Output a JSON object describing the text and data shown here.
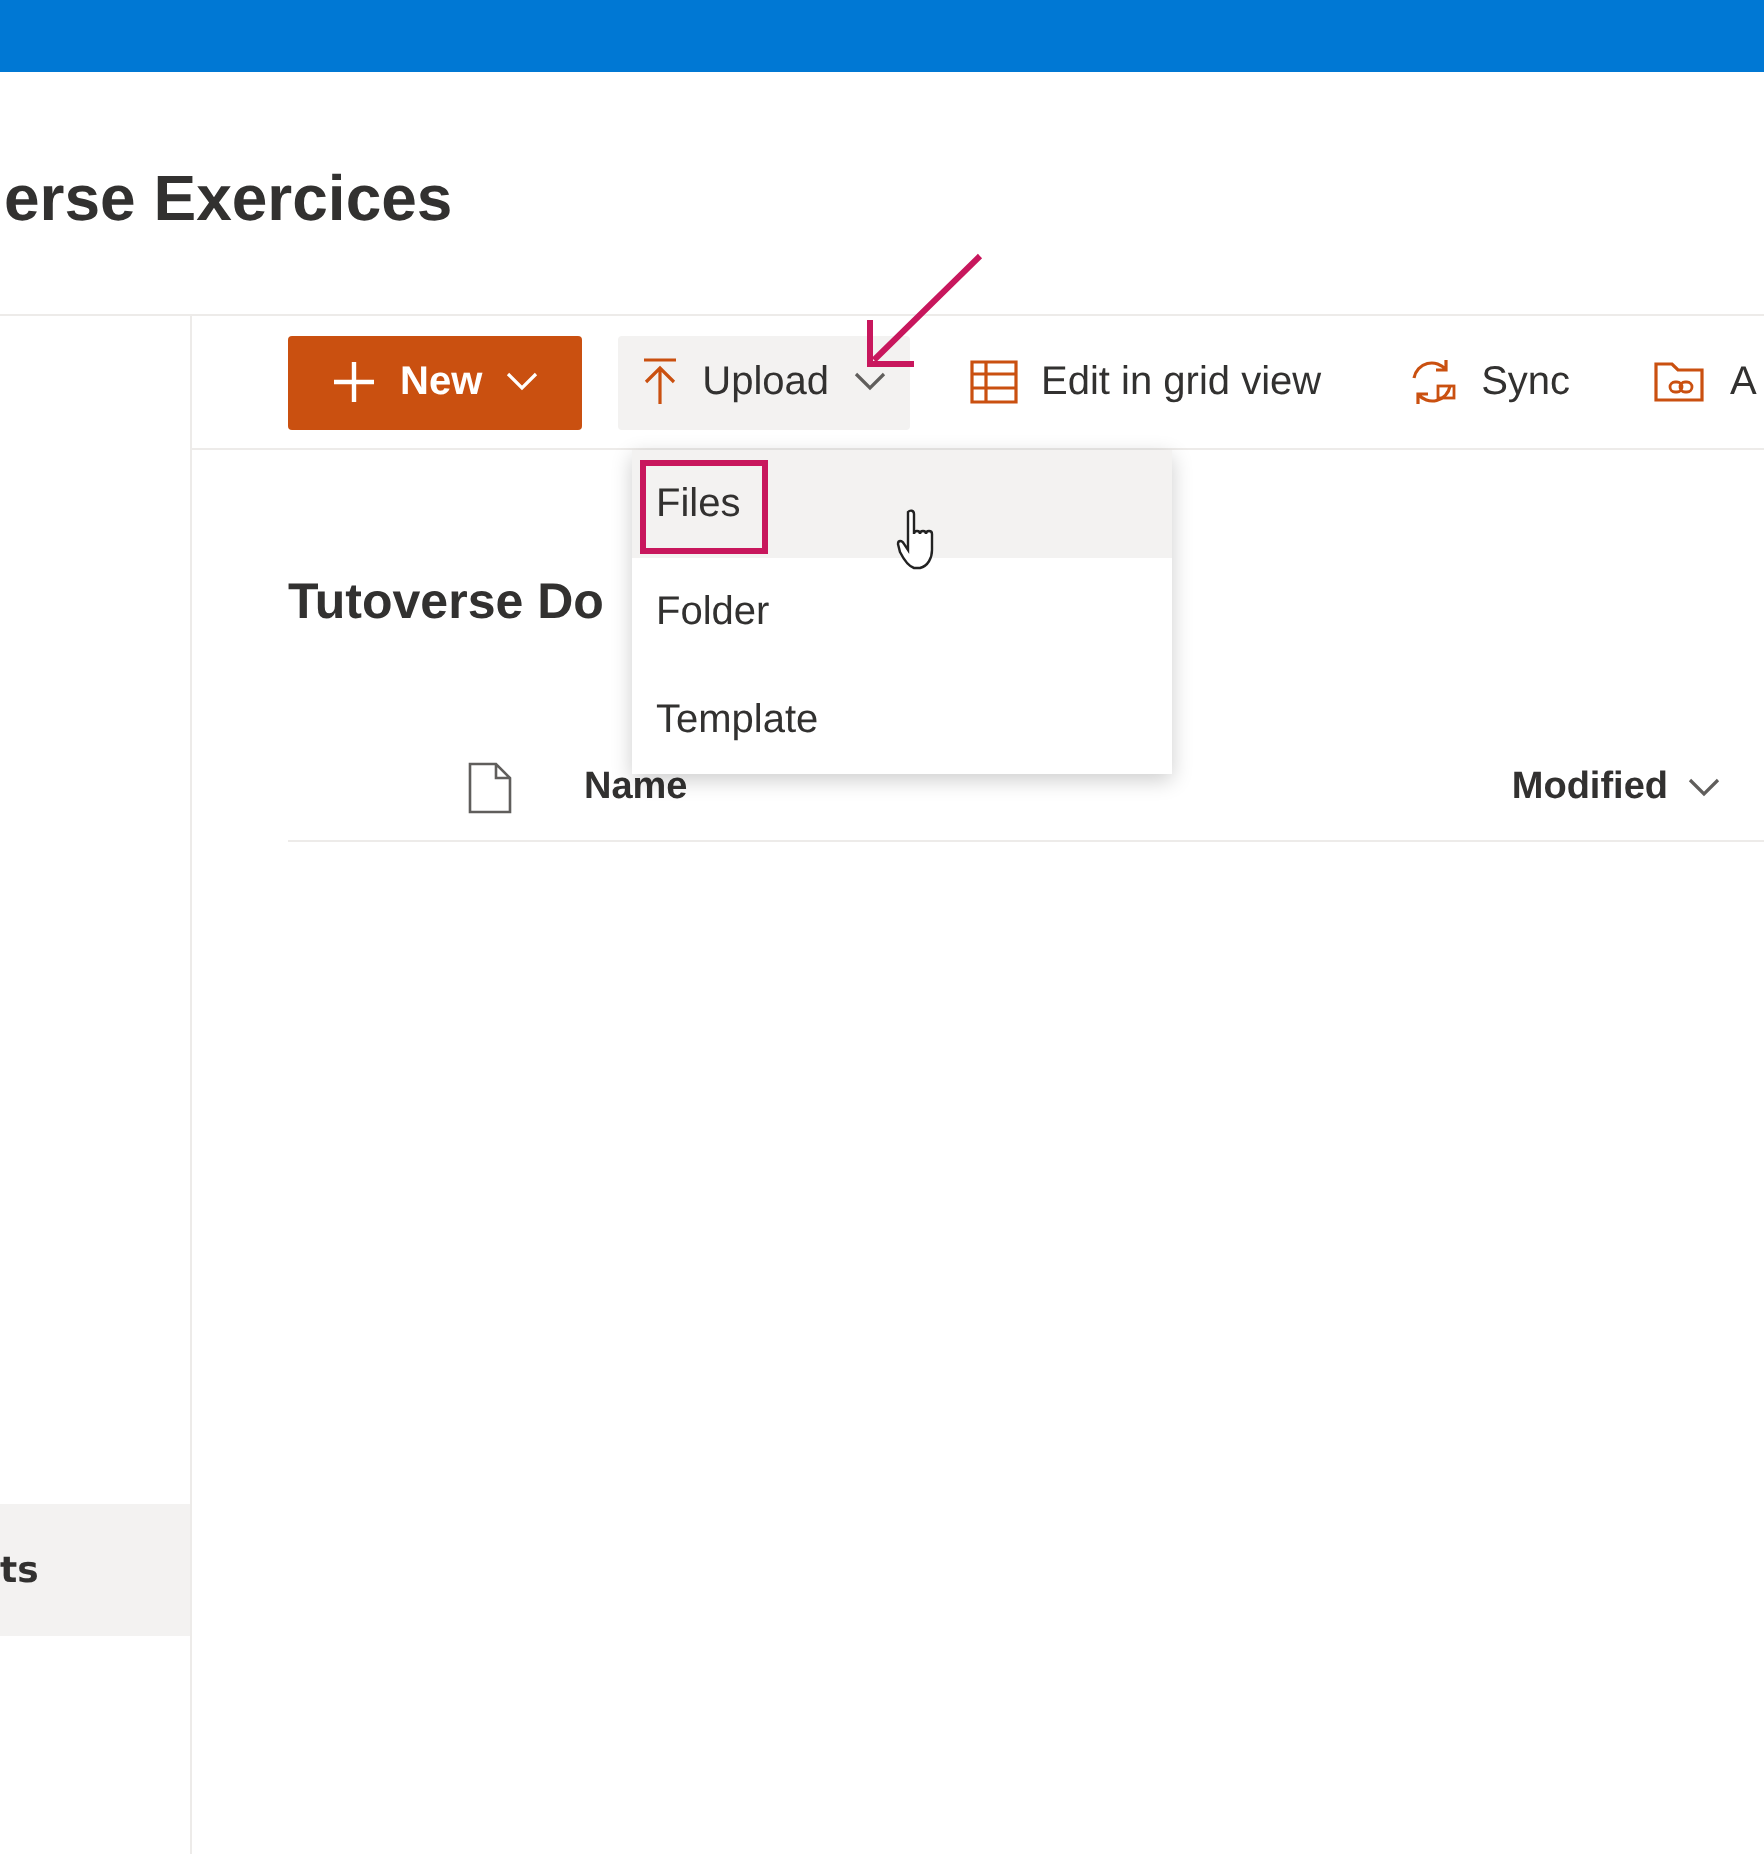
{
  "site": {
    "title": "erse Exercices"
  },
  "sidebar": {
    "items": [
      {
        "label": "ts",
        "selected": true
      }
    ]
  },
  "commands": [
    {
      "kind": "new",
      "label": "New",
      "expanded": false
    },
    {
      "kind": "upload",
      "label": "Upload",
      "expanded": true
    },
    {
      "kind": "grid",
      "label": "Edit in grid view",
      "expanded": false
    },
    {
      "kind": "sync",
      "label": "Sync",
      "expanded": false
    },
    {
      "kind": "link",
      "label": "A",
      "expanded": false
    }
  ],
  "upload_menu": {
    "items": [
      {
        "label": "Files",
        "selected": true
      },
      {
        "label": "Folder",
        "selected": false
      },
      {
        "label": "Template",
        "selected": false
      }
    ]
  },
  "library": {
    "title": "Tutoverse Do",
    "columns": [
      {
        "label": "Name",
        "sort_menu": false
      },
      {
        "label": "Modified",
        "sort_menu": true
      }
    ]
  }
}
